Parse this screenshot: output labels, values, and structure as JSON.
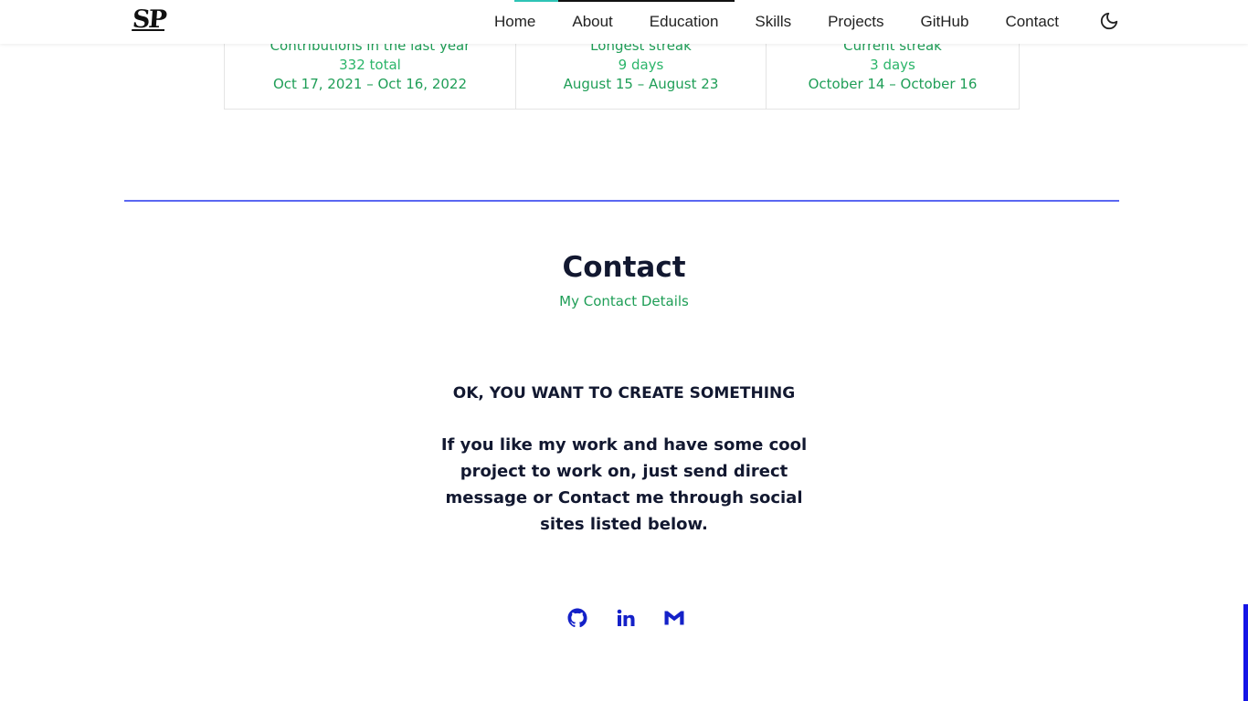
{
  "header": {
    "logo": "SP",
    "nav": [
      "Home",
      "About",
      "Education",
      "Skills",
      "Projects",
      "GitHub",
      "Contact"
    ],
    "theme_icon": "moon-icon"
  },
  "streak": {
    "contributions": {
      "label": "Contributions in the last year",
      "value": "332 total",
      "range": "Oct 17, 2021 – Oct 16, 2022"
    },
    "longest": {
      "label": "Longest streak",
      "value": "9 days",
      "range": "August 15 – August 23"
    },
    "current": {
      "label": "Current streak",
      "value": "3 days",
      "range": "October 14 – October 16"
    }
  },
  "contact": {
    "title": "Contact",
    "subtitle": "My Contact Details",
    "heading": "OK, YOU WANT TO CREATE SOMETHING",
    "text": "If you like my work and have some cool project to work on, just send direct message or Contact me through social sites listed below.",
    "social_icons": [
      "github-icon",
      "linkedin-icon",
      "gmail-icon"
    ]
  },
  "colors": {
    "accent_green": "#1f9e57",
    "divider_blue": "#5a67f2",
    "icon_blue": "#1421c8",
    "heading_dark": "#121830"
  }
}
